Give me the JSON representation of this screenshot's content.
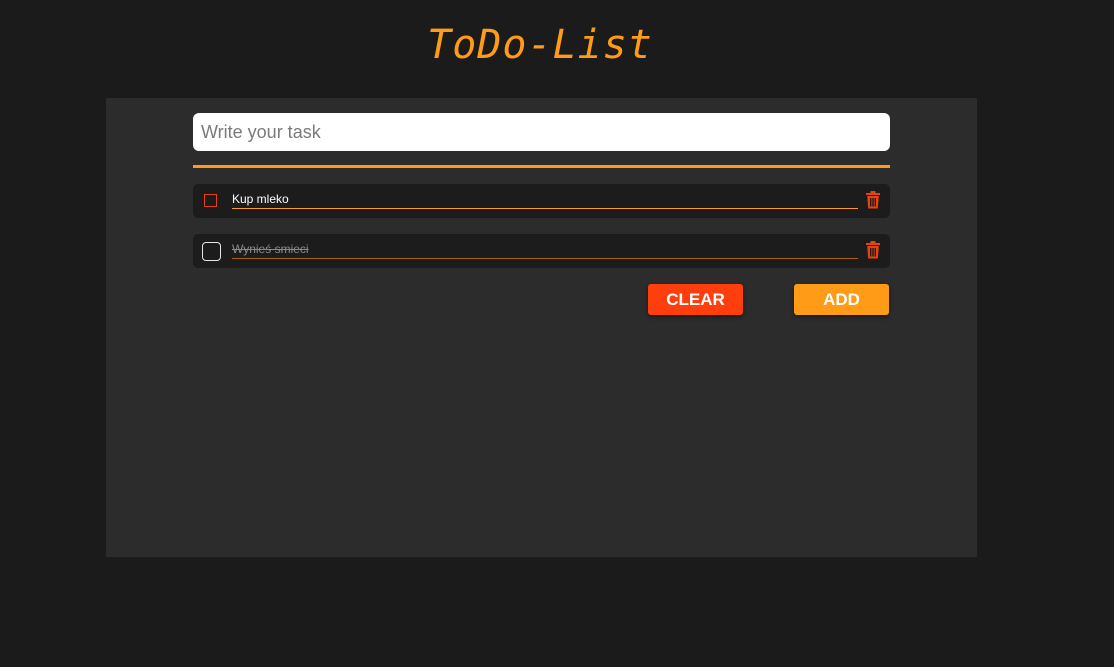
{
  "header": {
    "title": "ToDo-List"
  },
  "form": {
    "placeholder": "Write your task"
  },
  "tasks": [
    {
      "text": "Kup mleko",
      "done": false
    },
    {
      "text": "Wynieś smieci",
      "done": true
    }
  ],
  "actions": {
    "clear_label": "CLEAR",
    "add_label": "ADD"
  },
  "colors": {
    "accent": "#ff9b16",
    "danger": "#ff3e0e",
    "background": "#1b1b1b",
    "panel": "#2c2c2c"
  },
  "icons": {
    "delete": "trash-icon"
  }
}
